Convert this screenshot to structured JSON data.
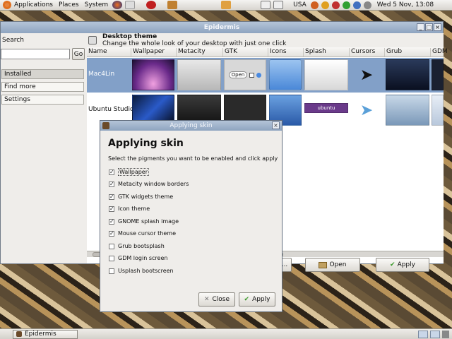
{
  "top_panel": {
    "menus": [
      "Applications",
      "Places",
      "System"
    ],
    "keyboard": "USA",
    "clock": "Wed  5 Nov, 13:08"
  },
  "window": {
    "title": "Epidermis",
    "controls": [
      "_",
      "□",
      "×"
    ]
  },
  "sidebar": {
    "search_label": "Search",
    "search_value": "",
    "go_label": "Go",
    "items": [
      {
        "label": "Installed",
        "selected": true
      },
      {
        "label": "Find more",
        "selected": false
      },
      {
        "label": "Settings",
        "selected": false
      }
    ]
  },
  "content": {
    "title": "Desktop theme",
    "subtitle": "Change the whole look of your desktop with just one click",
    "columns": [
      "Name",
      "Wallpaper",
      "Metacity",
      "GTK",
      "Icons",
      "Splash",
      "Cursors",
      "Grub",
      "GDM"
    ],
    "rows": [
      {
        "name": "Mac4Lin",
        "selected": true
      },
      {
        "name": "Ubuntu Studio",
        "selected": false
      }
    ],
    "gtk_open_label": "Open",
    "ubuntu_splash_text": "ubuntu",
    "more_label": "...",
    "open_label": "Open",
    "apply_label": "Apply"
  },
  "dialog": {
    "title": "Applying skin",
    "heading": "Applying skin",
    "text": "Select the pigments you want to be enabled and click apply",
    "options": [
      {
        "label": "Wallpaper",
        "checked": true
      },
      {
        "label": "Metacity window borders",
        "checked": true
      },
      {
        "label": "GTK widgets theme",
        "checked": true
      },
      {
        "label": "Icon theme",
        "checked": true
      },
      {
        "label": "GNOME splash image",
        "checked": true
      },
      {
        "label": "Mouse cursor theme",
        "checked": true
      },
      {
        "label": "Grub bootsplash",
        "checked": false
      },
      {
        "label": "GDM login screen",
        "checked": false
      },
      {
        "label": "Usplash bootscreen",
        "checked": false
      }
    ],
    "close_label": "Close",
    "apply_label": "Apply"
  },
  "taskbar": {
    "task_label": "Epidermis"
  },
  "colors": {
    "selection": "#82a0c8",
    "titlebar": "#9fb2cb"
  }
}
